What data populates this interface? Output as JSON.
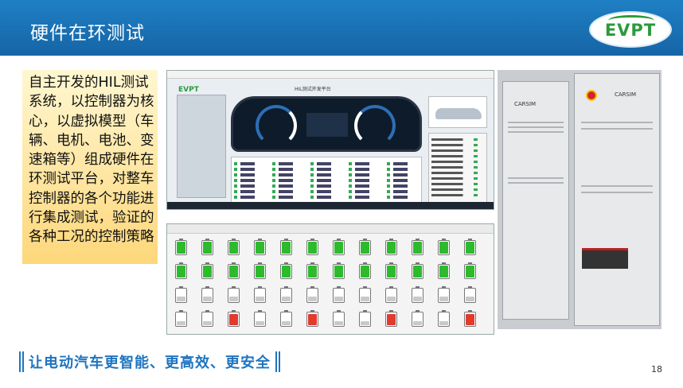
{
  "header": {
    "title": "硬件在环测试",
    "logo_text": "EVPT"
  },
  "description": "自主开发的HIL测试系统，以控制器为核心，以虚拟模型（车辆、电机、电池、变速箱等）组成硬件在环测试平台，对整车控制器的各个功能进行集成测试，验证的各种工况的控制策略",
  "screenshot_hil": {
    "logo": "EVPT",
    "title": "HIL测试开发平台"
  },
  "photo": {
    "rack_left_label": "CARSIM",
    "rack_right_label": "CARSIM"
  },
  "footer": {
    "slogan": "让电动汽车更智能、更高效、更安全",
    "page_number": "18"
  },
  "colors": {
    "header_blue": "#1565a6",
    "accent_green": "#2c9a3c",
    "slogan_blue": "#1f74c0",
    "desc_box": "#fdd77a"
  }
}
